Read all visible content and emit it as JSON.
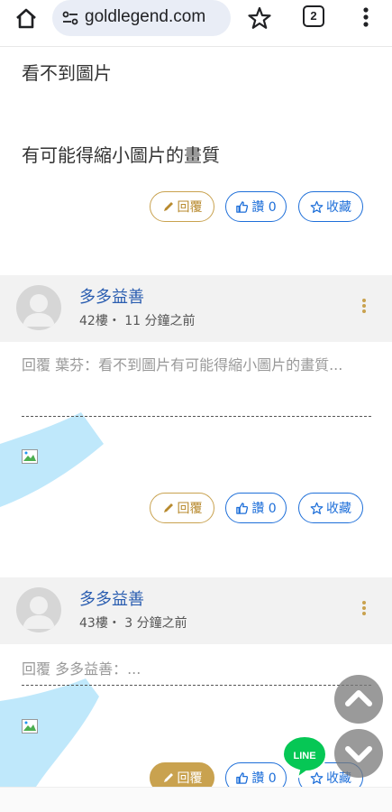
{
  "browser": {
    "url": "goldlegend.com",
    "tab_count": "2"
  },
  "post_top": {
    "lines": [
      "看不到圖片",
      "有可能得縮小圖片的畫質"
    ]
  },
  "actions": {
    "reply_label": "回覆",
    "like_label": "讚 0",
    "fav_label": "收藏"
  },
  "posts": [
    {
      "author": "多多益善",
      "floor": "42樓・ 11 分鐘之前",
      "quote": "回覆 葉芬：看不到圖片有可能得縮小圖片的畫質..."
    },
    {
      "author": "多多益善",
      "floor": "43樓・ 3 分鐘之前",
      "quote": "回覆 多多益善：..."
    }
  ],
  "line_badge": "LINE",
  "colors": {
    "gold": "#c9a24f",
    "blue": "#1e6fd9",
    "author_blue": "#2a5db0",
    "line_green": "#06c755",
    "deco_cyan": "#bfe8fb"
  },
  "icons": [
    "home-icon",
    "tune-icon",
    "star-icon",
    "tabs-icon",
    "more-vert-icon",
    "pencil-icon",
    "thumbs-up-icon",
    "star-outline-icon",
    "broken-image-icon",
    "chevron-up-icon",
    "chevron-down-icon",
    "line-icon"
  ]
}
